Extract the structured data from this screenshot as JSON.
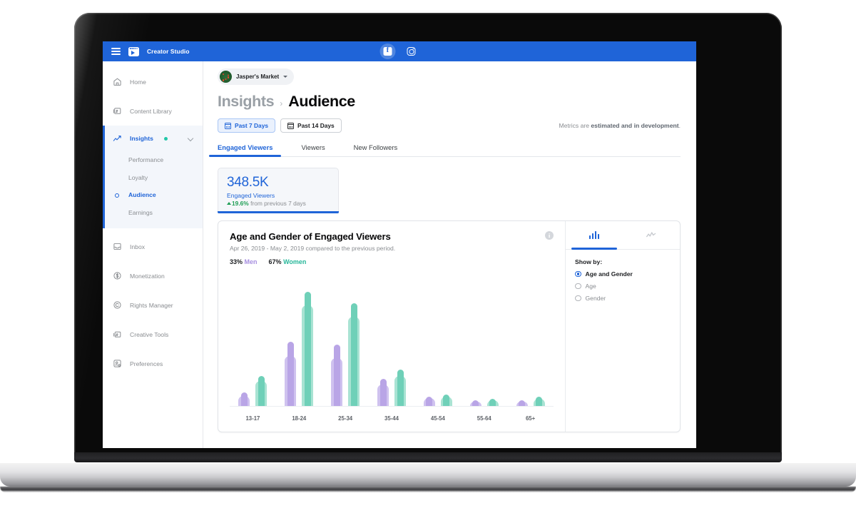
{
  "topnav": {
    "menu_icon": "hamburger-icon",
    "brand": "Creator Studio",
    "platform_tabs": [
      {
        "name": "facebook",
        "icon": "facebook-icon",
        "active": true
      },
      {
        "name": "instagram",
        "icon": "instagram-icon",
        "active": false
      }
    ]
  },
  "sidebar": {
    "items": [
      {
        "label": "Home",
        "icon": "home-icon"
      },
      {
        "label": "Content Library",
        "icon": "content-library-icon"
      },
      {
        "label": "Insights",
        "icon": "insights-icon",
        "badge_dot": true,
        "expanded": true
      },
      {
        "label": "Inbox",
        "icon": "inbox-icon"
      },
      {
        "label": "Monetization",
        "icon": "monetization-icon"
      },
      {
        "label": "Rights Manager",
        "icon": "rights-manager-icon"
      },
      {
        "label": "Creative Tools",
        "icon": "creative-tools-icon"
      },
      {
        "label": "Preferences",
        "icon": "preferences-icon"
      }
    ],
    "insights_subitems": [
      {
        "label": "Performance",
        "active": false
      },
      {
        "label": "Loyalty",
        "active": false
      },
      {
        "label": "Audience",
        "active": true
      },
      {
        "label": "Earnings",
        "active": false
      }
    ]
  },
  "account": {
    "name": "Jasper's Market",
    "avatar": "jaspers-market-avatar",
    "caret": "chevron-down-icon"
  },
  "breadcrumb": {
    "parent": "Insights",
    "separator": "›",
    "current": "Audience"
  },
  "date_filters": [
    {
      "label": "Past 7 Days",
      "active": true,
      "icon": "calendar-icon"
    },
    {
      "label": "Past 14 Days",
      "active": false,
      "icon": "calendar-icon"
    }
  ],
  "metrics_note": {
    "prefix": "Metrics are ",
    "emphasis": "estimated and in development",
    "suffix": "."
  },
  "tabs": [
    {
      "label": "Engaged Viewers",
      "active": true
    },
    {
      "label": "Viewers",
      "active": false
    },
    {
      "label": "New Followers",
      "active": false
    }
  ],
  "kpi": {
    "value": "348.5K",
    "label": "Engaged Viewers",
    "delta": "19.6%",
    "delta_direction": "up",
    "delta_suffix": " from previous 7 days"
  },
  "card": {
    "title": "Age and Gender of Engaged Viewers",
    "subtitle": "Apr 26, 2019 - May 2, 2019 compared to the previous period.",
    "info_icon": "info-icon",
    "legend": [
      {
        "pct": "33%",
        "label": "Men",
        "color": "#a78fe0"
      },
      {
        "pct": "67%",
        "label": "Women",
        "color": "#27b79a"
      }
    ],
    "chart_tabs": [
      {
        "name": "bar-chart-view",
        "icon": "bar-chart-icon",
        "active": true
      },
      {
        "name": "line-chart-view",
        "icon": "line-chart-icon",
        "active": false
      }
    ],
    "show_by": {
      "title": "Show by:",
      "options": [
        {
          "label": "Age and Gender",
          "selected": true
        },
        {
          "label": "Age",
          "selected": false
        },
        {
          "label": "Gender",
          "selected": false
        }
      ]
    }
  },
  "chart_data": {
    "type": "bar",
    "title": "Age and Gender of Engaged Viewers",
    "subtitle": "Apr 26, 2019 - May 2, 2019 compared to the previous period.",
    "xlabel": "",
    "ylabel": "",
    "grid": false,
    "legend_position": "top-left",
    "categories": [
      "13-17",
      "18-24",
      "25-34",
      "35-44",
      "45-54",
      "55-64",
      "65+"
    ],
    "ylim": [
      0,
      100
    ],
    "series": [
      {
        "name": "Men (current period)",
        "color": "#b9a5e6",
        "values": [
          12,
          56,
          54,
          24,
          8,
          5,
          5
        ]
      },
      {
        "name": "Men (previous period)",
        "color": "#cfc2ef",
        "values": [
          9,
          44,
          42,
          19,
          7,
          4,
          4
        ]
      },
      {
        "name": "Women (current period)",
        "color": "#6fd0b8",
        "values": [
          26,
          100,
          90,
          32,
          10,
          6,
          8
        ]
      },
      {
        "name": "Women (previous period)",
        "color": "#a9e3d3",
        "values": [
          22,
          88,
          78,
          26,
          8,
          5,
          6
        ]
      }
    ],
    "annotations": [
      "33% Men",
      "67% Women"
    ]
  }
}
